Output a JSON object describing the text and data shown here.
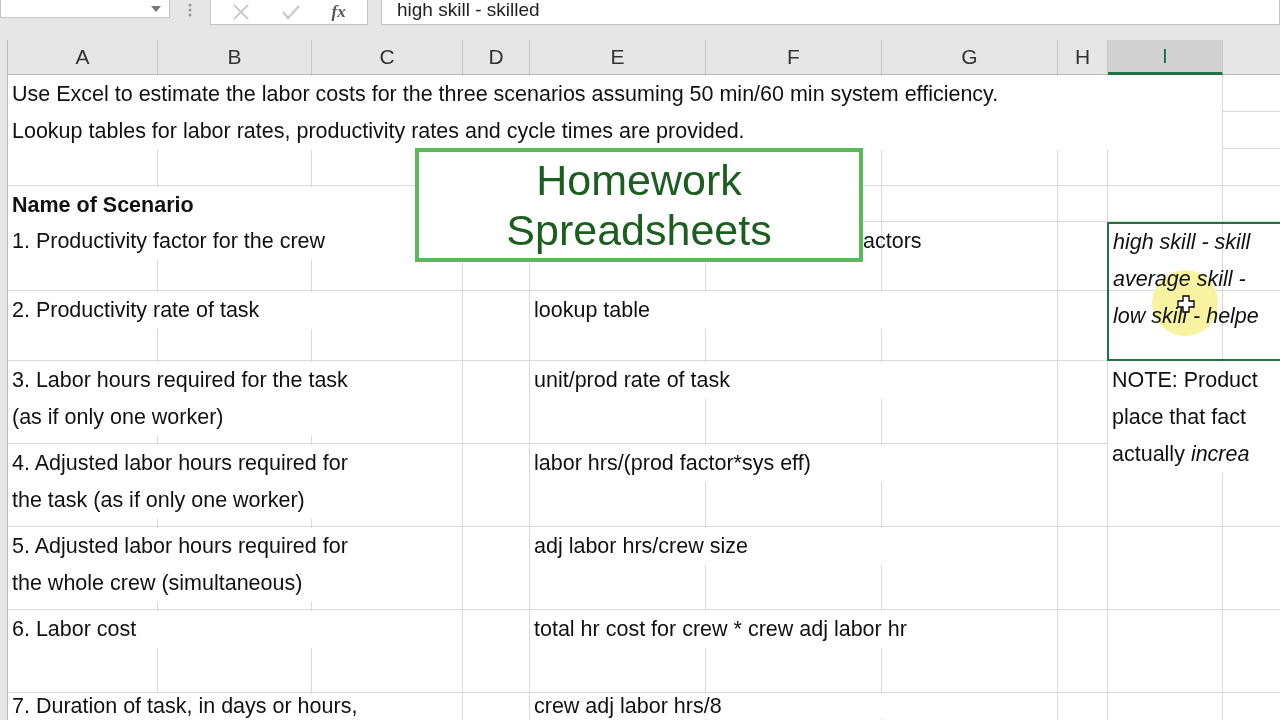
{
  "formula_bar": {
    "function_label": "fx",
    "value": "high skill - skilled"
  },
  "columns": [
    {
      "label": "A",
      "selected": false
    },
    {
      "label": "B",
      "selected": false
    },
    {
      "label": "C",
      "selected": false
    },
    {
      "label": "D",
      "selected": false
    },
    {
      "label": "E",
      "selected": false
    },
    {
      "label": "F",
      "selected": false
    },
    {
      "label": "G",
      "selected": false
    },
    {
      "label": "H",
      "selected": false
    },
    {
      "label": "I",
      "selected": true
    }
  ],
  "rows": [
    {
      "cells": [
        {
          "kind": "intro",
          "lines": [
            "Use Excel to estimate the labor costs for the three scenarios assuming 50 min/60 min system efficiency."
          ]
        }
      ]
    },
    {
      "cells": [
        {
          "kind": "intro",
          "lines": [
            "Lookup tables for labor rates, productivity rates and cycle times are provided."
          ]
        }
      ]
    },
    {
      "cells": [
        {
          "kind": "heading",
          "lines": [
            "Name of Scenario"
          ]
        }
      ]
    },
    {
      "cells": [
        {
          "kind": "label",
          "lines": [
            "1. Productivity factor for the crew"
          ]
        },
        {
          "kind": "clipped",
          "lines": [
            "actors"
          ]
        },
        {
          "kind": "legend",
          "selected": true,
          "lines": [
            "high skill - skill",
            "average skill -",
            "low skill - helpe"
          ]
        }
      ]
    },
    {
      "cells": [
        {
          "kind": "label",
          "lines": [
            "2. Productivity rate of task"
          ]
        },
        {
          "kind": "formula",
          "lines": [
            "lookup table"
          ]
        }
      ]
    },
    {
      "cells": [
        {
          "kind": "label",
          "lines": [
            "3. Labor hours required for the task",
            "(as if only one worker)"
          ]
        },
        {
          "kind": "formula",
          "lines": [
            "unit/prod rate of task"
          ]
        },
        {
          "kind": "note",
          "lines": [
            "NOTE: Product",
            "place that fact",
            "actually *increa*"
          ]
        }
      ]
    },
    {
      "cells": [
        {
          "kind": "label",
          "lines": [
            "4. Adjusted labor hours required for",
            "the task (as if only one worker)"
          ]
        },
        {
          "kind": "formula",
          "lines": [
            "labor hrs/(prod factor*sys eff)"
          ]
        }
      ]
    },
    {
      "cells": [
        {
          "kind": "label",
          "lines": [
            "5. Adjusted labor hours required for",
            "the whole crew (simultaneous)"
          ]
        },
        {
          "kind": "formula",
          "lines": [
            "adj labor hrs/crew size"
          ]
        }
      ]
    },
    {
      "cells": [
        {
          "kind": "label",
          "lines": [
            "6. Labor cost"
          ]
        },
        {
          "kind": "formula",
          "lines": [
            "total hr cost for crew * crew adj labor hr"
          ]
        }
      ]
    },
    {
      "cells": [
        {
          "kind": "label",
          "lines": [
            "7. Duration of task, in days or hours,"
          ]
        },
        {
          "kind": "formula",
          "lines": [
            "crew adj labor hrs/8"
          ]
        }
      ]
    }
  ],
  "overlay_title": "Homework Spreadsheets"
}
